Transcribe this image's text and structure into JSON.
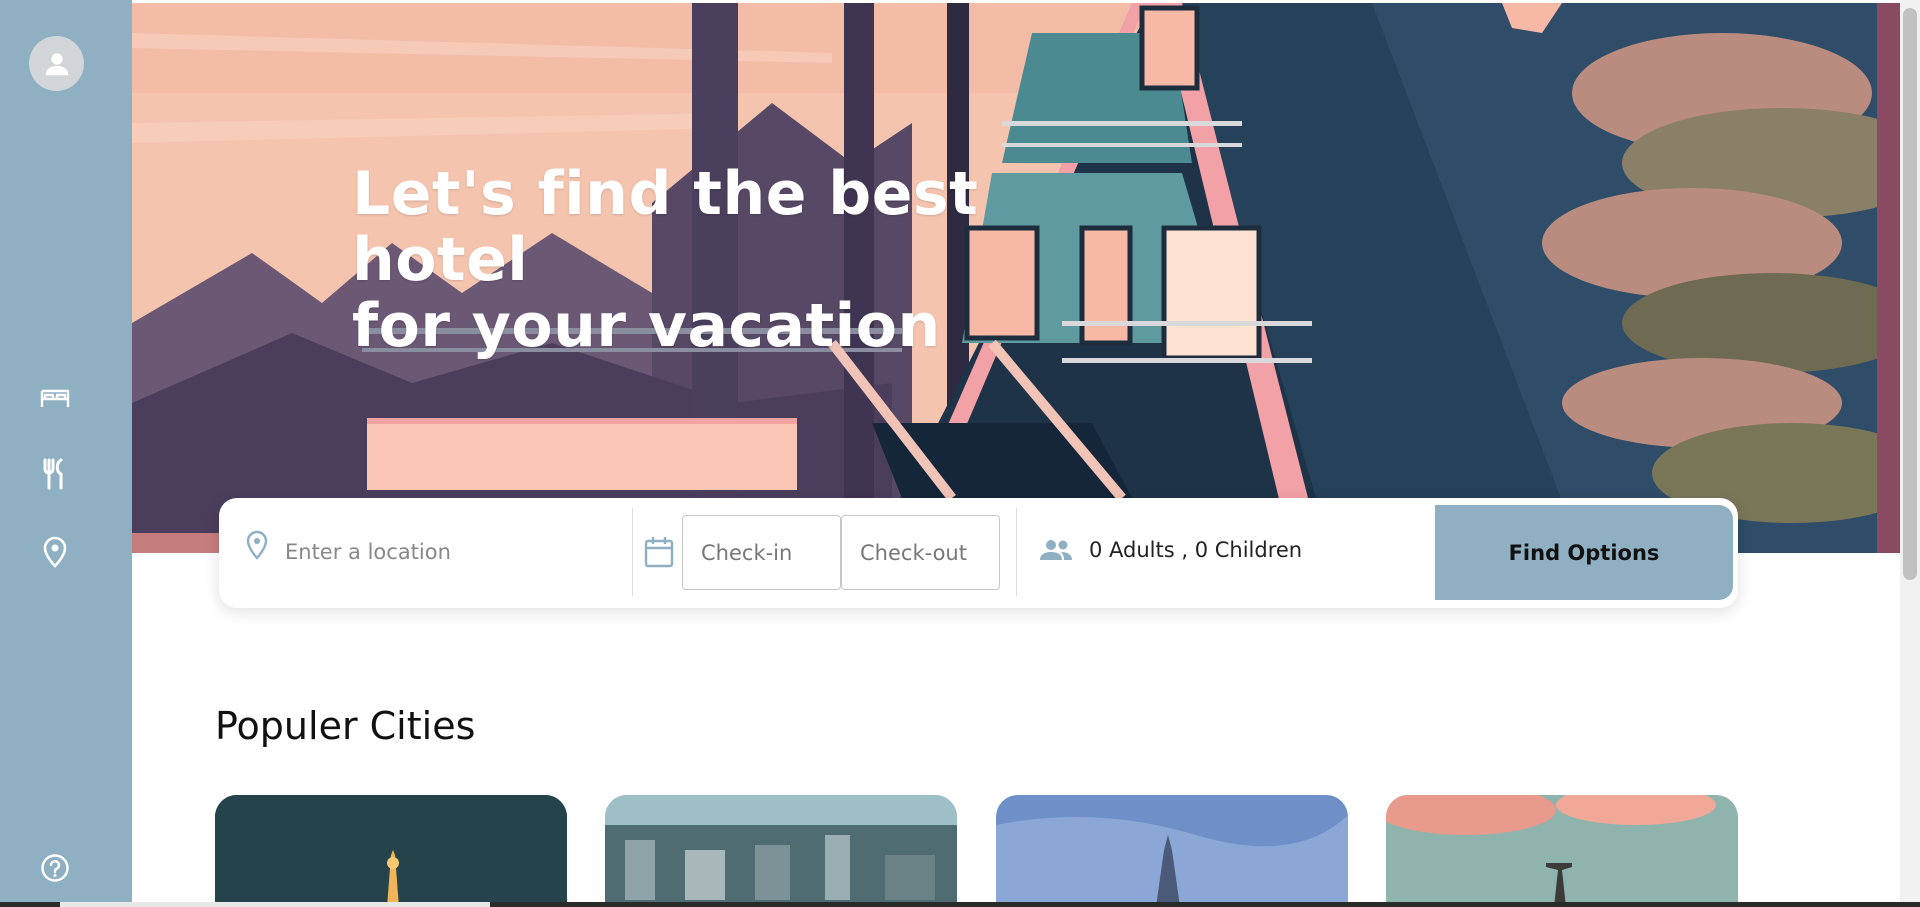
{
  "hero": {
    "title_line1": "Let's find the best hotel",
    "title_line2": "for your vacation"
  },
  "sidebar": {
    "icons": [
      "user-icon",
      "bed-icon",
      "restaurant-icon",
      "location-pin-icon",
      "help-icon"
    ]
  },
  "search": {
    "location_placeholder": "Enter a location",
    "checkin_placeholder": "Check-in",
    "checkout_placeholder": "Check-out",
    "guests": "0 Adults , 0 Children",
    "find_button": "Find Options"
  },
  "popular": {
    "title": "Populer Cities"
  },
  "colors": {
    "sidebar": "#8fb0c2",
    "accent": "#8fb0c2",
    "hero_sky": "#f5c4ae",
    "hero_house": "#26415a"
  }
}
